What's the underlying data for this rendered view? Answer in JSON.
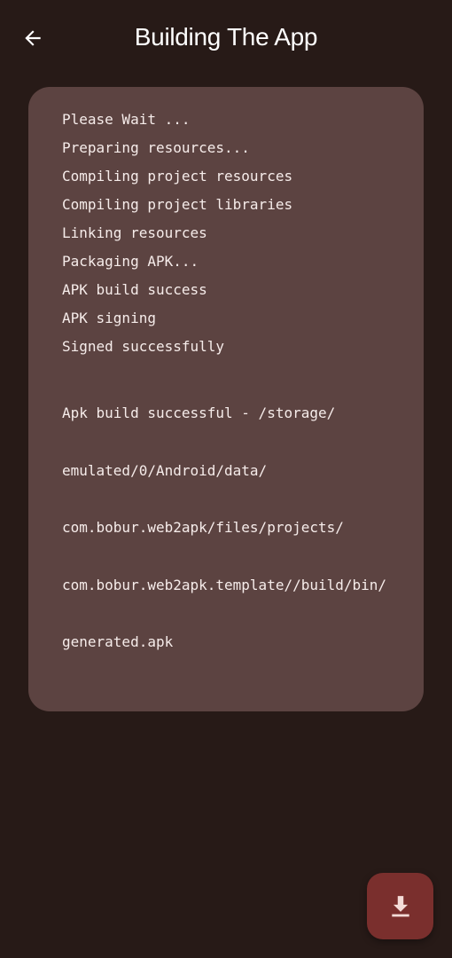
{
  "header": {
    "title": "Building The App",
    "back_icon": "arrow-left-icon"
  },
  "log": {
    "lines": [
      "Please Wait ...",
      "Preparing resources...",
      "Compiling project resources",
      "Compiling project libraries",
      "Linking resources",
      "Packaging APK...",
      "APK build success",
      "APK signing",
      "Signed successfully"
    ],
    "final_line_segments": [
      "Apk build successful - /storage/",
      "emulated/0/Android/data/",
      "com.bobur.web2apk/files/projects/",
      "com.bobur.web2apk.template//build/bin/",
      "generated.apk"
    ]
  },
  "fab": {
    "icon": "download-icon"
  },
  "colors": {
    "background": "#271a17",
    "card": "#5c4341",
    "fab": "#7a2f2d",
    "text": "#f6ecea"
  }
}
